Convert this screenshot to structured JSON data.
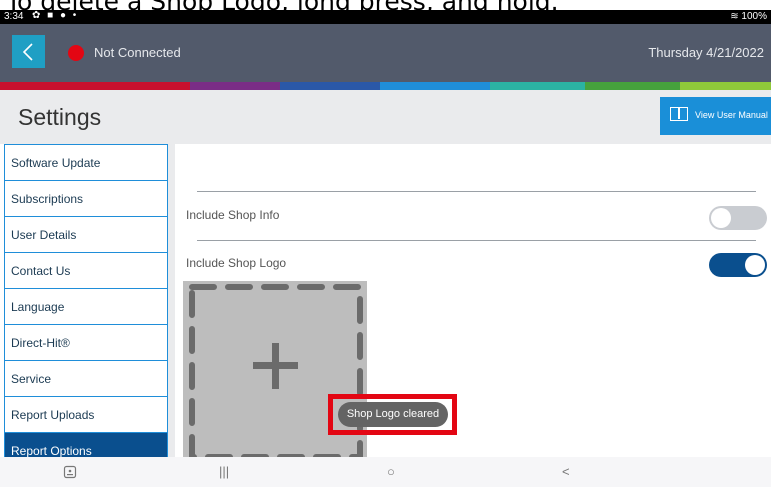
{
  "caption": "To delete a Shop Logo, long press, and hold.",
  "status_bar": {
    "time": "3:34",
    "icons": "✿ ■ ● •",
    "battery": "≋ 100%"
  },
  "header": {
    "connection_status": "Not Connected",
    "date": "Thursday 4/21/2022"
  },
  "page": {
    "title": "Settings",
    "manual_button": "View User Manual"
  },
  "sidebar": {
    "items": [
      {
        "label": "Software Update"
      },
      {
        "label": "Subscriptions"
      },
      {
        "label": "User Details"
      },
      {
        "label": "Contact Us"
      },
      {
        "label": "Language"
      },
      {
        "label": "Direct-Hit®"
      },
      {
        "label": "Service"
      },
      {
        "label": "Report Uploads"
      },
      {
        "label": "Report Options"
      }
    ]
  },
  "content": {
    "shop_info_label": "Include Shop Info",
    "shop_info_enabled": false,
    "shop_logo_label": "Include Shop Logo",
    "shop_logo_enabled": true,
    "toast": "Shop Logo cleared"
  },
  "nav_bar": {
    "recents": "|||",
    "home": "○",
    "back": "<"
  },
  "colors": {
    "header_bg": "#525a6b",
    "accent_blue": "#1a8fd8",
    "active_blue": "#0a4f8e",
    "status_red": "#e30613",
    "highlight_red": "#e30613"
  },
  "color_strip": [
    "#c8102e",
    "#7a2d86",
    "#2a58a8",
    "#1f8ed9",
    "#2bb3a3",
    "#46a23d",
    "#8fc83a"
  ]
}
